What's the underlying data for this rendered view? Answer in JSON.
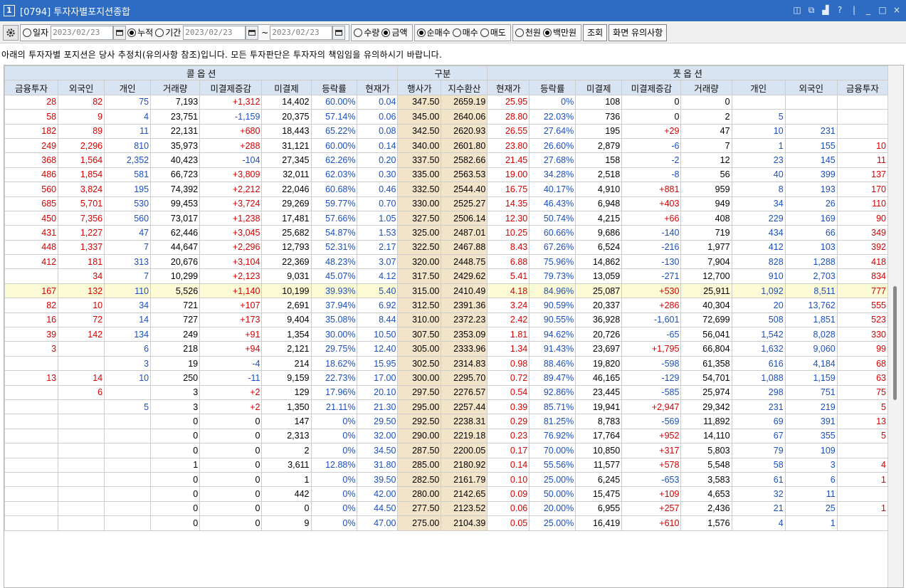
{
  "window": {
    "num": "1",
    "title": "[0794] 투자자별포지션종합",
    "controls": [
      "◫",
      "⧉",
      "▟",
      "?",
      "|",
      "_",
      "□",
      "×"
    ]
  },
  "toolbar": {
    "r_date": "일자",
    "date1": "2023/02/23",
    "r_cum": "누적",
    "r_period": "기간",
    "date2": "2023/02/23",
    "tilde": "~",
    "date3": "2023/02/23",
    "r_qty": "수량",
    "r_amt": "금액",
    "r_net": "순매수",
    "r_buy": "매수",
    "r_sell": "매도",
    "r_thou": "천원",
    "r_mil": "백만원",
    "btn_query": "조회",
    "btn_notice": "화면 유의사항"
  },
  "notice": "아래의 투자자별 포지션은 당사 추정치(유의사항 참조)입니다. 모든 투자판단은 투자자의 책임임을 유의하시기 바랍니다.",
  "grid": {
    "group_call": "콜 옵 션",
    "group_mid": "구분",
    "group_put": "풋 옵 션",
    "headers": [
      "금융투자",
      "외국인",
      "개인",
      "거래량",
      "미결제증감",
      "미결제",
      "등락률",
      "현재가",
      "행사가",
      "지수환산",
      "현재가",
      "등락률",
      "미결제",
      "미결제증감",
      "거래량",
      "개인",
      "외국인",
      "금융투자"
    ],
    "rows": [
      [
        "28",
        "82",
        "75",
        "7,193",
        "+1,312",
        "14,402",
        "60.00%",
        "0.04",
        "347.50",
        "2659.19",
        "25.95",
        "0%",
        "108",
        "0",
        "0",
        "",
        "",
        ""
      ],
      [
        "58",
        "9",
        "4",
        "23,751",
        "-1,159",
        "20,375",
        "57.14%",
        "0.06",
        "345.00",
        "2640.06",
        "28.80",
        "22.03%",
        "736",
        "0",
        "2",
        "5",
        "",
        ""
      ],
      [
        "182",
        "89",
        "11",
        "22,131",
        "+680",
        "18,443",
        "65.22%",
        "0.08",
        "342.50",
        "2620.93",
        "26.55",
        "27.64%",
        "195",
        "+29",
        "47",
        "10",
        "231",
        ""
      ],
      [
        "249",
        "2,296",
        "810",
        "35,973",
        "+288",
        "31,121",
        "60.00%",
        "0.14",
        "340.00",
        "2601.80",
        "23.80",
        "26.60%",
        "2,879",
        "-6",
        "7",
        "1",
        "155",
        "10"
      ],
      [
        "368",
        "1,564",
        "2,352",
        "40,423",
        "-104",
        "27,345",
        "62.26%",
        "0.20",
        "337.50",
        "2582.66",
        "21.45",
        "27.68%",
        "158",
        "-2",
        "12",
        "23",
        "145",
        "11"
      ],
      [
        "486",
        "1,854",
        "581",
        "66,723",
        "+3,809",
        "32,011",
        "62.03%",
        "0.30",
        "335.00",
        "2563.53",
        "19.00",
        "34.28%",
        "2,518",
        "-8",
        "56",
        "40",
        "399",
        "137"
      ],
      [
        "560",
        "3,824",
        "195",
        "74,392",
        "+2,212",
        "22,046",
        "60.68%",
        "0.46",
        "332.50",
        "2544.40",
        "16.75",
        "40.17%",
        "4,910",
        "+881",
        "959",
        "8",
        "193",
        "170"
      ],
      [
        "685",
        "5,701",
        "530",
        "99,453",
        "+3,724",
        "29,269",
        "59.77%",
        "0.70",
        "330.00",
        "2525.27",
        "14.35",
        "46.43%",
        "6,948",
        "+403",
        "949",
        "34",
        "26",
        "110"
      ],
      [
        "450",
        "7,356",
        "560",
        "73,017",
        "+1,238",
        "17,481",
        "57.66%",
        "1.05",
        "327.50",
        "2506.14",
        "12.30",
        "50.74%",
        "4,215",
        "+66",
        "408",
        "229",
        "169",
        "90"
      ],
      [
        "431",
        "1,227",
        "47",
        "62,446",
        "+3,045",
        "25,682",
        "54.87%",
        "1.53",
        "325.00",
        "2487.01",
        "10.25",
        "60.66%",
        "9,686",
        "-140",
        "719",
        "434",
        "66",
        "349"
      ],
      [
        "448",
        "1,337",
        "7",
        "44,647",
        "+2,296",
        "12,793",
        "52.31%",
        "2.17",
        "322.50",
        "2467.88",
        "8.43",
        "67.26%",
        "6,524",
        "-216",
        "1,977",
        "412",
        "103",
        "392"
      ],
      [
        "412",
        "181",
        "313",
        "20,676",
        "+3,104",
        "22,369",
        "48.23%",
        "3.07",
        "320.00",
        "2448.75",
        "6.88",
        "75.96%",
        "14,862",
        "-130",
        "7,904",
        "828",
        "1,288",
        "418"
      ],
      [
        "",
        "34",
        "7",
        "10,299",
        "+2,123",
        "9,031",
        "45.07%",
        "4.12",
        "317.50",
        "2429.62",
        "5.41",
        "79.73%",
        "13,059",
        "-271",
        "12,700",
        "910",
        "2,703",
        "834"
      ],
      [
        "167",
        "132",
        "110",
        "5,526",
        "+1,140",
        "10,199",
        "39.93%",
        "5.40",
        "315.00",
        "2410.49",
        "4.18",
        "84.96%",
        "25,087",
        "+530",
        "25,911",
        "1,092",
        "8,511",
        "777"
      ],
      [
        "82",
        "10",
        "34",
        "721",
        "+107",
        "2,691",
        "37.94%",
        "6.92",
        "312.50",
        "2391.36",
        "3.24",
        "90.59%",
        "20,337",
        "+286",
        "40,304",
        "20",
        "13,762",
        "555"
      ],
      [
        "16",
        "72",
        "14",
        "727",
        "+173",
        "9,404",
        "35.08%",
        "8.44",
        "310.00",
        "2372.23",
        "2.42",
        "90.55%",
        "36,928",
        "-1,601",
        "72,699",
        "508",
        "1,851",
        "523"
      ],
      [
        "39",
        "142",
        "134",
        "249",
        "+91",
        "1,354",
        "30.00%",
        "10.50",
        "307.50",
        "2353.09",
        "1.81",
        "94.62%",
        "20,726",
        "-65",
        "56,041",
        "1,542",
        "8,028",
        "330"
      ],
      [
        "3",
        "",
        "6",
        "218",
        "+94",
        "2,121",
        "29.75%",
        "12.40",
        "305.00",
        "2333.96",
        "1.34",
        "91.43%",
        "23,697",
        "+1,795",
        "66,804",
        "1,632",
        "9,060",
        "99"
      ],
      [
        "",
        "",
        "3",
        "19",
        "-4",
        "214",
        "18.62%",
        "15.95",
        "302.50",
        "2314.83",
        "0.98",
        "88.46%",
        "19,820",
        "-598",
        "61,358",
        "616",
        "4,184",
        "68"
      ],
      [
        "13",
        "14",
        "10",
        "250",
        "-11",
        "9,159",
        "22.73%",
        "17.00",
        "300.00",
        "2295.70",
        "0.72",
        "89.47%",
        "46,165",
        "-129",
        "54,701",
        "1,088",
        "1,159",
        "63"
      ],
      [
        "",
        "6",
        "",
        "3",
        "+2",
        "129",
        "17.96%",
        "20.10",
        "297.50",
        "2276.57",
        "0.54",
        "92.86%",
        "23,445",
        "-585",
        "25,974",
        "298",
        "751",
        "75"
      ],
      [
        "",
        "",
        "5",
        "3",
        "+2",
        "1,350",
        "21.11%",
        "21.30",
        "295.00",
        "2257.44",
        "0.39",
        "85.71%",
        "19,941",
        "+2,947",
        "29,342",
        "231",
        "219",
        "5"
      ],
      [
        "",
        "",
        "",
        "0",
        "0",
        "147",
        "0%",
        "29.50",
        "292.50",
        "2238.31",
        "0.29",
        "81.25%",
        "8,783",
        "-569",
        "11,892",
        "69",
        "391",
        "13"
      ],
      [
        "",
        "",
        "",
        "0",
        "0",
        "2,313",
        "0%",
        "32.00",
        "290.00",
        "2219.18",
        "0.23",
        "76.92%",
        "17,764",
        "+952",
        "14,110",
        "67",
        "355",
        "5"
      ],
      [
        "",
        "",
        "",
        "0",
        "0",
        "2",
        "0%",
        "34.50",
        "287.50",
        "2200.05",
        "0.17",
        "70.00%",
        "10,850",
        "+317",
        "5,803",
        "79",
        "109",
        ""
      ],
      [
        "",
        "",
        "",
        "1",
        "0",
        "3,611",
        "12.88%",
        "31.80",
        "285.00",
        "2180.92",
        "0.14",
        "55.56%",
        "11,577",
        "+578",
        "5,548",
        "58",
        "3",
        "4"
      ],
      [
        "",
        "",
        "",
        "0",
        "0",
        "1",
        "0%",
        "39.50",
        "282.50",
        "2161.79",
        "0.10",
        "25.00%",
        "6,245",
        "-653",
        "3,583",
        "61",
        "6",
        "1"
      ],
      [
        "",
        "",
        "",
        "0",
        "0",
        "442",
        "0%",
        "42.00",
        "280.00",
        "2142.65",
        "0.09",
        "50.00%",
        "15,475",
        "+109",
        "4,653",
        "32",
        "11",
        ""
      ],
      [
        "",
        "",
        "",
        "0",
        "0",
        "0",
        "0%",
        "44.50",
        "277.50",
        "2123.52",
        "0.06",
        "20.00%",
        "6,955",
        "+257",
        "2,436",
        "21",
        "25",
        "1"
      ],
      [
        "",
        "",
        "",
        "0",
        "0",
        "9",
        "0%",
        "47.00",
        "275.00",
        "2104.39",
        "0.05",
        "25.00%",
        "16,419",
        "+610",
        "1,576",
        "4",
        "1",
        ""
      ]
    ],
    "highlight_row": 13
  },
  "colors": {
    "title_bar": "#2d6cc2",
    "header_bg": "#d9e4f2",
    "mid_bg": "#f2e4c8",
    "highlight": "#fdfbd5",
    "red": "#d40000",
    "blue": "#1b4fbf"
  },
  "icons": {
    "gear": "gear-icon",
    "calendar": "calendar-icon"
  }
}
